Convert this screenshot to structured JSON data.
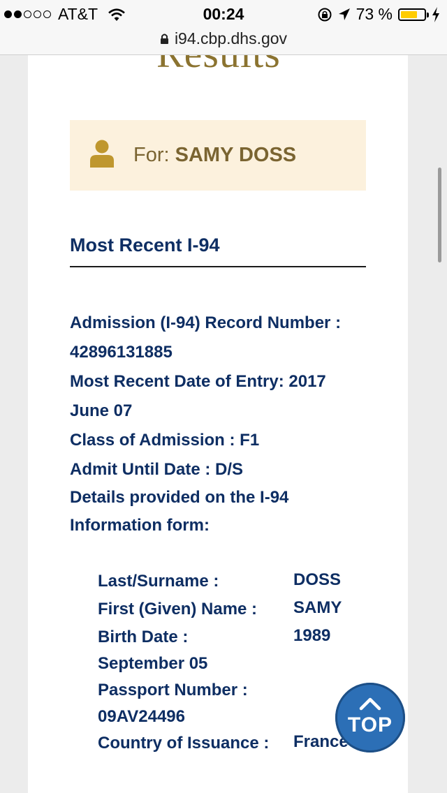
{
  "status_bar": {
    "carrier": "AT&T",
    "time": "00:24",
    "battery_percent": "73 %",
    "battery_level": 0.73,
    "signal_bars_filled": 2,
    "signal_bars_total": 5
  },
  "browser": {
    "url": "i94.cbp.dhs.gov"
  },
  "page": {
    "title": "Results",
    "for_label": "For:",
    "for_name": "SAMY DOSS",
    "section_title": "Most Recent I-94",
    "record_number_label": "Admission (I-94) Record Number :",
    "record_number_value": "42896131885",
    "entry_date_label": "Most Recent Date of Entry:",
    "entry_date_value_1": "2017",
    "entry_date_value_2": "June 07",
    "class_label": "Class of Admission :",
    "class_value": "F1",
    "admit_until_label": "Admit Until Date :",
    "admit_until_value": "D/S",
    "details_line_1": "Details provided on the I-94",
    "details_line_2": "Information form:",
    "details": {
      "surname_label": "Last/Surname :",
      "surname_value": "DOSS",
      "given_name_label": "First (Given) Name :",
      "given_name_value": "SAMY",
      "birth_date_label": "Birth Date :",
      "birth_date_value_1": "1989",
      "birth_date_value_2": "September 05",
      "passport_label": "Passport Number :",
      "passport_value": "09AV24496",
      "country_label": "Country of Issuance :",
      "country_value": "France"
    },
    "top_button_label": "TOP"
  },
  "colors": {
    "heading_navy": "#0e2e63",
    "gold": "#8b7330",
    "for_box_bg": "#fcf1dd",
    "top_button": "#2c6fb6"
  }
}
